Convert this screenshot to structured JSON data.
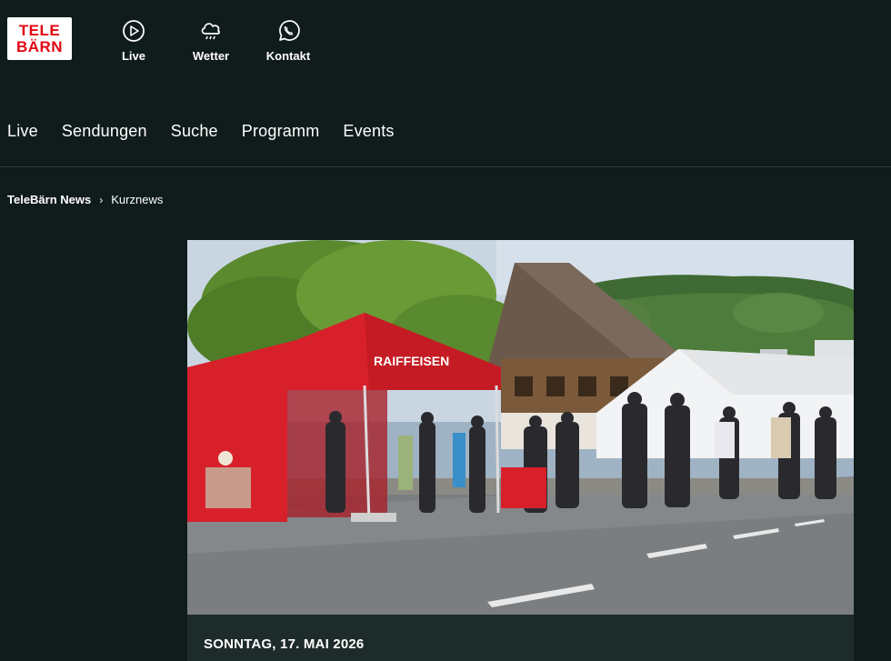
{
  "brand": {
    "line1": "TELE",
    "line2": "BÄRN",
    "color": "#e30613"
  },
  "quicklinks": [
    {
      "label": "Live",
      "icon": "play-icon"
    },
    {
      "label": "Wetter",
      "icon": "cloud-rain-icon"
    },
    {
      "label": "Kontakt",
      "icon": "whatsapp-icon"
    }
  ],
  "nav": [
    "Live",
    "Sendungen",
    "Suche",
    "Programm",
    "Events"
  ],
  "breadcrumb": {
    "parent": "TeleBärn News",
    "current": "Kurznews"
  },
  "article": {
    "tent_brand": "RAIFFEISEN",
    "date": "SONNTAG, 17. MAI 2026"
  },
  "colors": {
    "background": "#0f1c1b",
    "caption_bg": "#1d2b2a",
    "tent_red": "#d8202a"
  }
}
